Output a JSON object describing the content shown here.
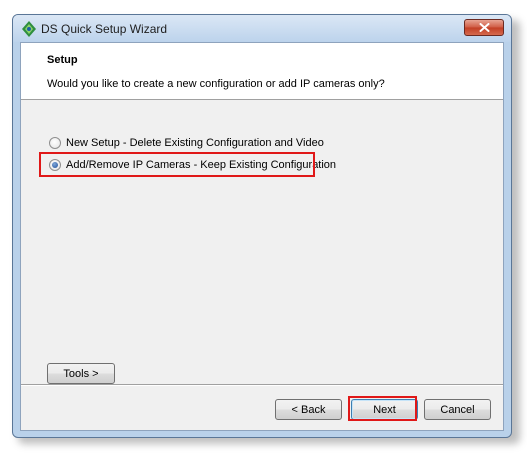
{
  "window": {
    "title": "DS Quick Setup Wizard"
  },
  "header": {
    "title": "Setup",
    "subtitle": "Would you like to create a new configuration or add IP cameras only?"
  },
  "options": [
    {
      "label": "New Setup - Delete Existing Configuration and Video",
      "selected": false
    },
    {
      "label": "Add/Remove IP Cameras - Keep Existing Configuration",
      "selected": true
    }
  ],
  "buttons": {
    "tools": "Tools >",
    "back": "< Back",
    "next": "Next",
    "cancel": "Cancel"
  },
  "colors": {
    "highlight": "#e01818",
    "titlebar": "#bcd3ec",
    "close_button": "#c23e24"
  }
}
